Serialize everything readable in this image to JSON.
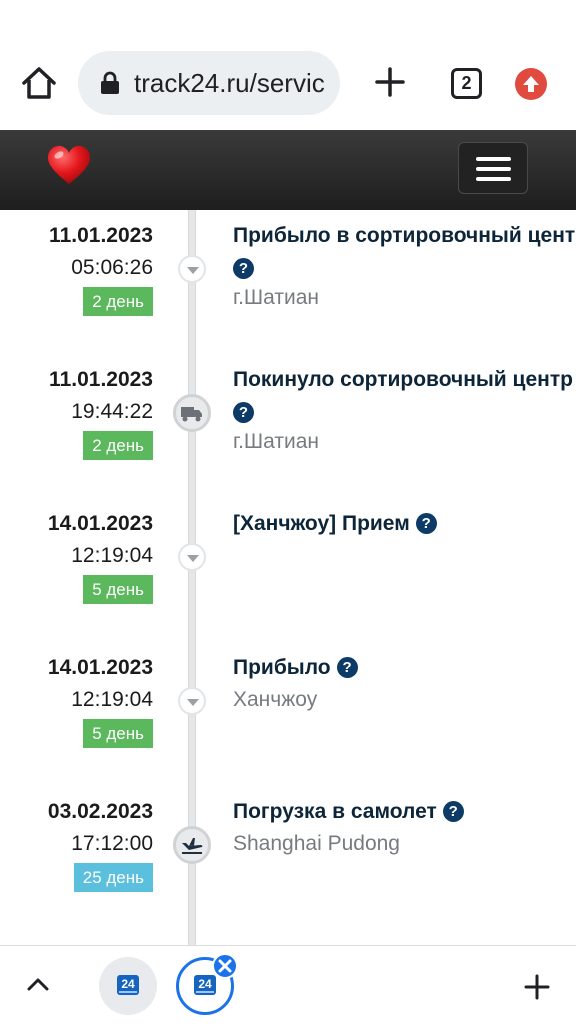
{
  "browser": {
    "url": "track24.ru/servic",
    "tab_count": "2",
    "icons": [
      "home-icon",
      "lock-icon",
      "plus-icon",
      "tab-switcher-icon",
      "update-icon"
    ]
  },
  "site": {
    "logo": "heart-logo",
    "menu": "hamburger-icon"
  },
  "timeline": {
    "events": [
      {
        "date": "11.01.2023",
        "time": "05:06:26",
        "days": "2 день",
        "title": "Прибыло в сортировочный цент",
        "help": "?",
        "place": "г.Шатиан",
        "icon": "arrow-down-icon",
        "badge_color": "#5cb85c"
      },
      {
        "date": "11.01.2023",
        "time": "19:44:22",
        "days": "2 день",
        "title": "Покинуло сортировочный центр",
        "help": "?",
        "place": "г.Шатиан",
        "icon": "truck-icon",
        "badge_color": "#5cb85c"
      },
      {
        "date": "14.01.2023",
        "time": "12:19:04",
        "days": "5 день",
        "title": "[Ханчжоу] Прием",
        "help": "?",
        "place": "",
        "icon": "arrow-down-icon",
        "badge_color": "#5cb85c"
      },
      {
        "date": "14.01.2023",
        "time": "12:19:04",
        "days": "5 день",
        "title": "Прибыло",
        "help": "?",
        "place": "Ханчжоу",
        "icon": "arrow-down-icon",
        "badge_color": "#5cb85c"
      },
      {
        "date": "03.02.2023",
        "time": "17:12:00",
        "days": "25 день",
        "title": "Погрузка в самолет",
        "help": "?",
        "place": "Shanghai Pudong",
        "icon": "airplane-icon",
        "badge_color": "#5bc0de"
      }
    ]
  },
  "bottom_bar": {
    "tab_favicon_label": "24",
    "icons": [
      "chevron-up-icon",
      "close-icon",
      "plus-icon"
    ]
  }
}
